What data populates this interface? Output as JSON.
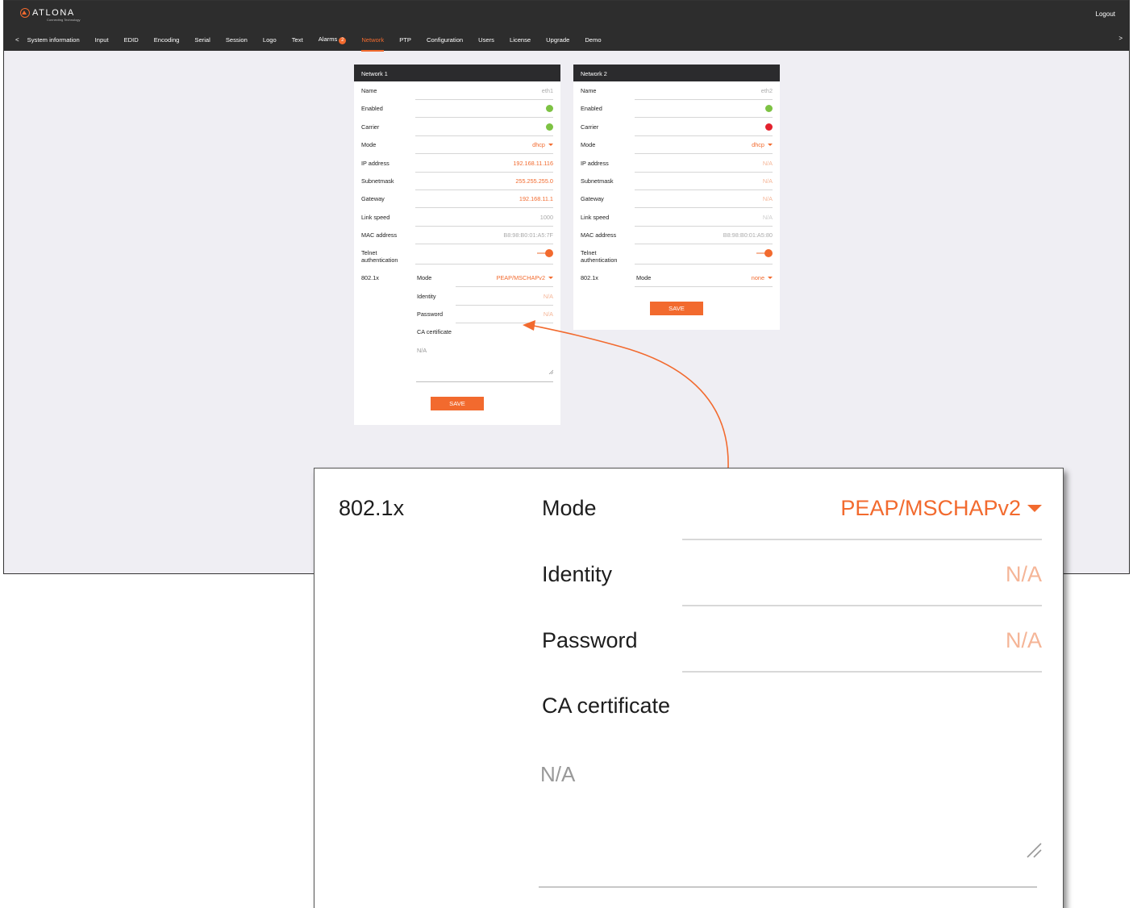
{
  "brand": {
    "name": "ATLONA",
    "tagline": "Connecting Technology"
  },
  "header": {
    "logout": "Logout",
    "nav_prev": "<",
    "nav_next": ">",
    "tabs": [
      {
        "label": "System information"
      },
      {
        "label": "Input"
      },
      {
        "label": "EDID"
      },
      {
        "label": "Encoding"
      },
      {
        "label": "Serial"
      },
      {
        "label": "Session"
      },
      {
        "label": "Logo"
      },
      {
        "label": "Text"
      },
      {
        "label": "Alarms",
        "badge": "2"
      },
      {
        "label": "Network",
        "active": true
      },
      {
        "label": "PTP"
      },
      {
        "label": "Configuration"
      },
      {
        "label": "Users"
      },
      {
        "label": "License"
      },
      {
        "label": "Upgrade"
      },
      {
        "label": "Demo"
      }
    ]
  },
  "network1": {
    "title": "Network 1",
    "name_label": "Name",
    "name": "eth1",
    "enabled_label": "Enabled",
    "enabled_status": "green",
    "carrier_label": "Carrier",
    "carrier_status": "green",
    "mode_label": "Mode",
    "mode": "dhcp",
    "ip_label": "IP address",
    "ip": "192.168.11.116",
    "subnet_label": "Subnetmask",
    "subnet": "255.255.255.0",
    "gateway_label": "Gateway",
    "gateway": "192.168.11.1",
    "link_label": "Link speed",
    "link": "1000",
    "mac_label": "MAC address",
    "mac": "B8:98:B0:01:A5:7F",
    "telnet_label_1": "Telnet",
    "telnet_label_2": "authentication",
    "telnet_on": true,
    "dot1x_label": "802.1x",
    "dot1x_mode_label": "Mode",
    "dot1x_mode": "PEAP/MSCHAPv2",
    "identity_label": "Identity",
    "identity": "N/A",
    "password_label": "Password",
    "password": "N/A",
    "ca_label": "CA certificate",
    "ca_placeholder": "N/A",
    "save": "SAVE"
  },
  "network2": {
    "title": "Network 2",
    "name_label": "Name",
    "name": "eth2",
    "enabled_label": "Enabled",
    "enabled_status": "green",
    "carrier_label": "Carrier",
    "carrier_status": "red",
    "mode_label": "Mode",
    "mode": "dhcp",
    "ip_label": "IP address",
    "ip": "N/A",
    "subnet_label": "Subnetmask",
    "subnet": "N/A",
    "gateway_label": "Gateway",
    "gateway": "N/A",
    "link_label": "Link speed",
    "link": "N/A",
    "mac_label": "MAC address",
    "mac": "B8:98:B0:01:A5:80",
    "telnet_label_1": "Telnet",
    "telnet_label_2": "authentication",
    "telnet_on": true,
    "dot1x_label": "802.1x",
    "dot1x_mode_label": "Mode",
    "dot1x_mode": "none",
    "save": "SAVE"
  },
  "zoom": {
    "dot1x_label": "802.1x",
    "mode_label": "Mode",
    "mode": "PEAP/MSCHAPv2",
    "identity_label": "Identity",
    "identity": "N/A",
    "password_label": "Password",
    "password": "N/A",
    "ca_label": "CA certificate",
    "ca_placeholder": "N/A"
  },
  "colors": {
    "accent": "#f26a2e",
    "status_green": "#7dc243",
    "status_red": "#e3222d",
    "topbar": "#2d2d2d"
  }
}
